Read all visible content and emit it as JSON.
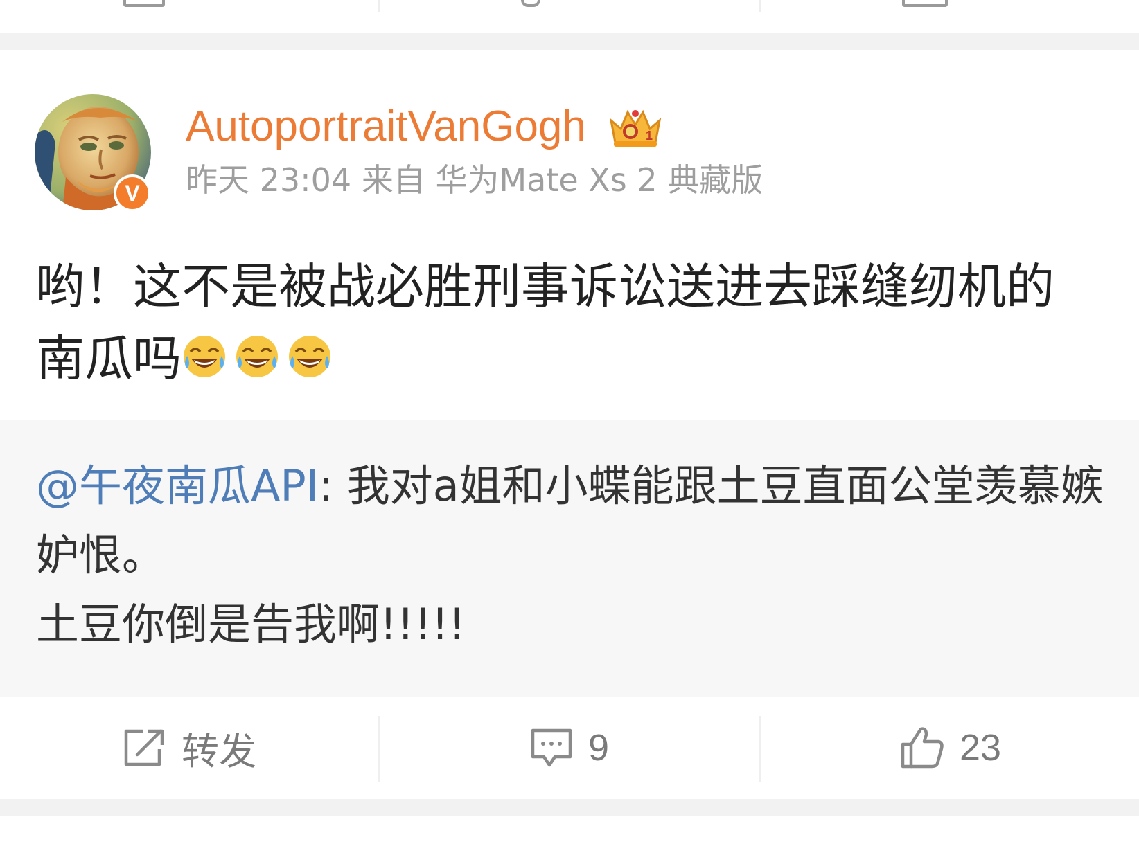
{
  "post": {
    "username": "AutoportraitVanGogh",
    "time": "昨天 23:04",
    "source_prefix": "来自",
    "source": "华为Mate Xs 2 典藏版",
    "content_line1": "哟！这不是被战必胜刑事诉讼送进去踩缝纫机的",
    "content_line2": "南瓜吗",
    "emojis": [
      "laugh-cry-emoji",
      "laugh-cry-emoji",
      "laugh-cry-emoji"
    ],
    "verified_mark": "V",
    "crown_badge": "1"
  },
  "retweet": {
    "mention": "@午夜南瓜API",
    "text_line1": ": 我对a姐和小蝶能跟土豆直面公堂羡慕嫉",
    "text_line2": "妒恨。",
    "text_line3": "土豆你倒是告我啊!!!!!"
  },
  "actions": {
    "repost_label": "转发",
    "comment_count": "9",
    "like_count": "23"
  },
  "colors": {
    "username": "#eb7b35",
    "mention": "#4f7db8",
    "meta": "#9e9e9e",
    "verified": "#f37d2a"
  }
}
